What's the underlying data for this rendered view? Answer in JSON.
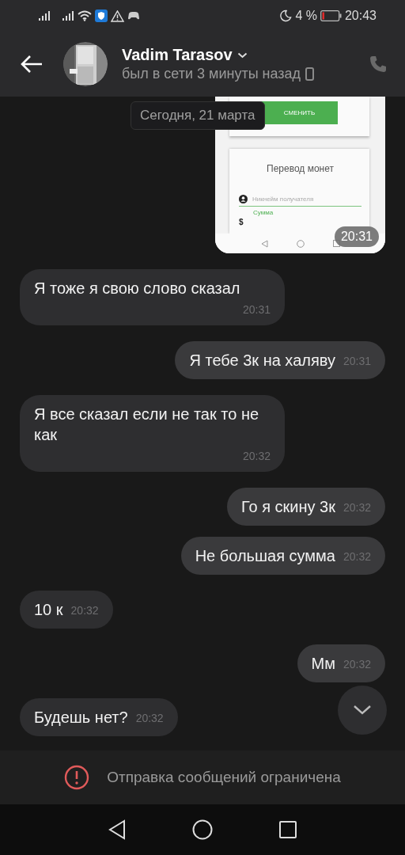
{
  "status_bar": {
    "battery_text": "4 %",
    "time": "20:43"
  },
  "header": {
    "name": "Vadim Tarasov",
    "last_seen": "был в сети 3 минуты назад"
  },
  "date_chip": "Сегодня, 21 марта",
  "messages": [
    {
      "outgoing": true,
      "time": "20:31",
      "screenshot": {
        "button": "СМЕНИТЬ",
        "card_title": "Перевод монет",
        "recipient_placeholder": "Никнейм получателя",
        "amount_label": "Сумма",
        "currency": "$"
      }
    },
    {
      "kind": "text",
      "outgoing": false,
      "text": "Я тоже я свою слово сказал",
      "time": "20:31"
    },
    {
      "kind": "text",
      "outgoing": true,
      "text": "Я тебе 3к на халяву",
      "time": "20:31"
    },
    {
      "kind": "text",
      "outgoing": false,
      "text": "Я все сказал если не так то не как",
      "time": "20:32"
    },
    {
      "kind": "text",
      "outgoing": true,
      "text": "Го я скину 3к",
      "time": "20:32"
    },
    {
      "kind": "text",
      "outgoing": true,
      "text": "Не большая сумма",
      "time": "20:32"
    },
    {
      "kind": "text",
      "outgoing": false,
      "text": "10 к",
      "time": "20:32"
    },
    {
      "kind": "text",
      "outgoing": true,
      "text": "Мм",
      "time": "20:32"
    },
    {
      "kind": "text",
      "outgoing": false,
      "text": "Будешь нет?",
      "time": "20:32"
    }
  ],
  "restriction_notice": "Отправка сообщений ограничена"
}
